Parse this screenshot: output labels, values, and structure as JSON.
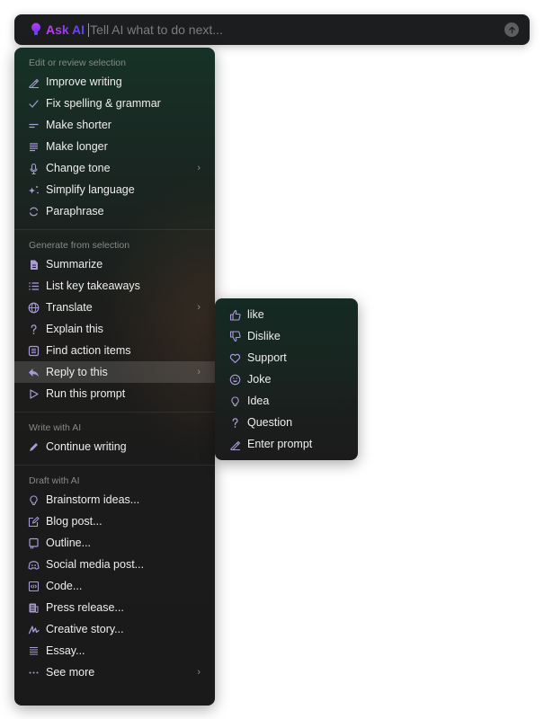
{
  "ask_bar": {
    "label": "Ask AI",
    "placeholder": "Tell AI what to do next...",
    "value": "",
    "brand_gradient": [
      "#c840f0",
      "#5a48f0"
    ]
  },
  "menu": {
    "sections": [
      {
        "title": "Edit or review selection",
        "items": [
          {
            "label": "Improve writing",
            "icon": "pen-icon"
          },
          {
            "label": "Fix spelling & grammar",
            "icon": "check-icon"
          },
          {
            "label": "Make shorter",
            "icon": "short-lines-icon"
          },
          {
            "label": "Make longer",
            "icon": "long-lines-icon"
          },
          {
            "label": "Change tone",
            "icon": "microphone-icon",
            "submenu": true
          },
          {
            "label": "Simplify language",
            "icon": "sparkle-icon"
          },
          {
            "label": "Paraphrase",
            "icon": "refresh-icon"
          }
        ]
      },
      {
        "title": "Generate from selection",
        "items": [
          {
            "label": "Summarize",
            "icon": "document-icon"
          },
          {
            "label": "List key takeaways",
            "icon": "list-icon"
          },
          {
            "label": "Translate",
            "icon": "globe-icon",
            "submenu": true
          },
          {
            "label": "Explain this",
            "icon": "question-icon"
          },
          {
            "label": "Find action items",
            "icon": "checklist-icon"
          },
          {
            "label": "Reply to this",
            "icon": "reply-icon",
            "submenu": true,
            "active": true
          },
          {
            "label": "Run this prompt",
            "icon": "play-icon"
          }
        ]
      },
      {
        "title": "Write with AI",
        "items": [
          {
            "label": "Continue writing",
            "icon": "pencil-icon"
          }
        ]
      },
      {
        "title": "Draft with AI",
        "items": [
          {
            "label": "Brainstorm ideas...",
            "icon": "lightbulb-icon"
          },
          {
            "label": "Blog post...",
            "icon": "edit-doc-icon"
          },
          {
            "label": "Outline...",
            "icon": "book-icon"
          },
          {
            "label": "Social media post...",
            "icon": "discord-icon"
          },
          {
            "label": "Code...",
            "icon": "code-icon"
          },
          {
            "label": "Press release...",
            "icon": "newspaper-icon"
          },
          {
            "label": "Creative story...",
            "icon": "scribble-icon"
          },
          {
            "label": "Essay...",
            "icon": "paragraph-icon"
          },
          {
            "label": "See more",
            "icon": "ellipsis-icon",
            "submenu": true
          }
        ]
      }
    ]
  },
  "reply_submenu": {
    "items": [
      {
        "label": "like",
        "icon": "thumbs-up-icon"
      },
      {
        "label": "Dislike",
        "icon": "thumbs-down-icon"
      },
      {
        "label": "Support",
        "icon": "heart-icon"
      },
      {
        "label": "Joke",
        "icon": "smile-icon"
      },
      {
        "label": "Idea",
        "icon": "lightbulb-icon"
      },
      {
        "label": "Question",
        "icon": "question-icon"
      },
      {
        "label": "Enter prompt",
        "icon": "pen-icon"
      }
    ]
  },
  "colors": {
    "icon_accent": "#a99bd6",
    "menu_text": "#eeeeee",
    "section_title": "#878a88"
  }
}
